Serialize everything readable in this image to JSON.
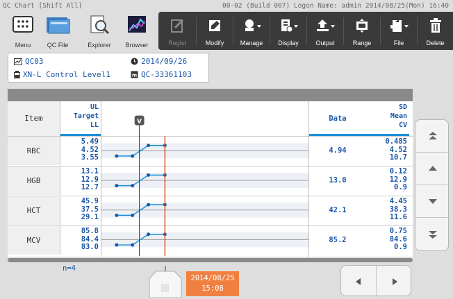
{
  "titlebar": {
    "left": "QC Chart [Shift All]",
    "right": "00-02 (Build 007)  Logon Name: admin  2014/08/25(Mon) 16:40"
  },
  "toolbar_left": [
    {
      "label": "Menu",
      "icon": "menu-icon"
    },
    {
      "label": "QC File",
      "icon": "qc-file-icon"
    },
    {
      "label": "Explorer",
      "icon": "explorer-icon"
    },
    {
      "label": "Browser",
      "icon": "browser-icon"
    }
  ],
  "toolbar_right": [
    {
      "label": "Regist",
      "icon": "regist-icon",
      "disabled": true
    },
    {
      "label": "Modify",
      "icon": "modify-icon"
    },
    {
      "label": "Manage",
      "icon": "manage-icon"
    },
    {
      "label": "Display",
      "icon": "display-icon"
    },
    {
      "label": "Output",
      "icon": "output-icon"
    },
    {
      "label": "Range",
      "icon": "range-icon"
    },
    {
      "label": "File",
      "icon": "file-icon"
    },
    {
      "label": "Delete",
      "icon": "delete-icon"
    }
  ],
  "info": {
    "qc_id": "QC03",
    "date": "2014/09/26",
    "material": "XN-L Control Level1",
    "lot": "QC-33361103"
  },
  "table": {
    "header_item": "Item",
    "header_limits": [
      "UL",
      "Target",
      "LL"
    ],
    "header_data": "Data",
    "header_stats": [
      "SD",
      "Mean",
      "CV"
    ],
    "marker_label": "V",
    "rows": [
      {
        "item": "RBC",
        "ul": "5.49",
        "target": "4.52",
        "ll": "3.55",
        "data": "4.94",
        "sd": "0.485",
        "mean": "4.52",
        "cv": "10.7"
      },
      {
        "item": "HGB",
        "ul": "13.1",
        "target": "12.9",
        "ll": "12.7",
        "data": "13.0",
        "sd": "0.12",
        "mean": "12.9",
        "cv": "0.9"
      },
      {
        "item": "HCT",
        "ul": "45.9",
        "target": "37.5",
        "ll": "29.1",
        "data": "42.1",
        "sd": "4.45",
        "mean": "38.3",
        "cv": "11.6"
      },
      {
        "item": "MCV",
        "ul": "85.8",
        "target": "84.4",
        "ll": "83.0",
        "data": "85.2",
        "sd": "0.75",
        "mean": "84.6",
        "cv": "0.9"
      }
    ],
    "n_label": "n=4"
  },
  "cursor_date": {
    "line1": "2014/08/25",
    "line2": "15:08"
  },
  "colors": {
    "accent": "#1a56a8",
    "cursor": "#e0502a",
    "badge": "#f08040",
    "toolbar": "#3a3a3a"
  }
}
